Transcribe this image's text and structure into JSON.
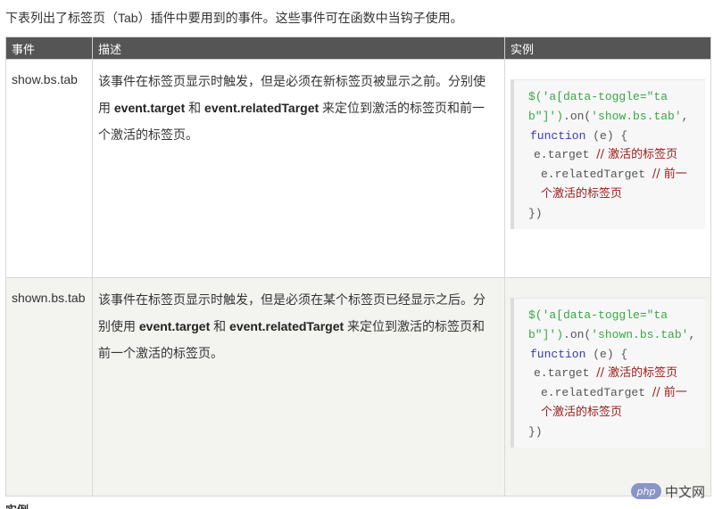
{
  "intro": "下表列出了标签页（Tab）插件中要用到的事件。这些事件可在函数中当钩子使用。",
  "table": {
    "headers": [
      "事件",
      "描述",
      "实例"
    ],
    "rows": [
      {
        "event": "show.bs.tab",
        "desc_parts": [
          "该事件在标签页显示时触发，但是必须在新标签页被显示之前。分别使用 ",
          "event.target",
          " 和 ",
          "event.relatedTarget",
          " 来定位到激活的标签页和前一个激活的标签页。"
        ],
        "code": {
          "l1_str": "$('a[data-toggle=\"tab\"]')",
          "l1_mid": ".on(",
          "l1_str2": "'show.bs.tab'",
          "l1_end": ",",
          "l2_kw": "function",
          "l2_rest": " (e) {",
          "l3_code": "e.target ",
          "l3_cm": "// 激活的标签页",
          "l4_code": "e.relatedTarget ",
          "l4_cm": "// 前一个激活的标签页",
          "l5": "})"
        }
      },
      {
        "event": "shown.bs.tab",
        "desc_parts": [
          "该事件在标签页显示时触发，但是必须在某个标签页已经显示之后。分别使用 ",
          "event.target",
          " 和 ",
          "event.relatedTarget",
          " 来定位到激活的标签页和前一个激活的标签页。"
        ],
        "code": {
          "l1_str": "$('a[data-toggle=\"tab\"]')",
          "l1_mid": ".on(",
          "l1_str2": "'shown.bs.tab'",
          "l1_end": ",",
          "l2_kw": "function",
          "l2_rest": " (e) {",
          "l3_code": "e.target ",
          "l3_cm": "// 激活的标签页",
          "l4_code": "e.relatedTarget ",
          "l4_cm": "// 前一个激活的标签页",
          "l5": "})"
        }
      }
    ]
  },
  "footer_partial": "实例",
  "watermark": {
    "logo": "php",
    "text": "中文网"
  }
}
